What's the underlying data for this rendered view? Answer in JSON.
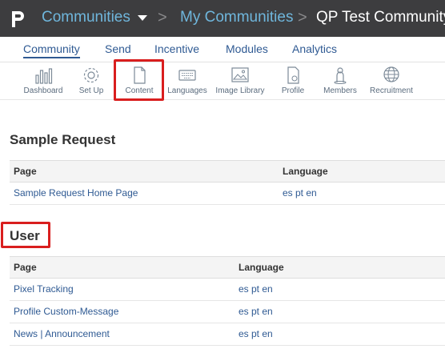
{
  "header": {
    "logo_icon": "p-logo-icon",
    "breadcrumb": [
      "Communities",
      "My Communities",
      "QP Test Community"
    ],
    "separator": ">"
  },
  "tabs": [
    {
      "label": "Community",
      "active": true
    },
    {
      "label": "Send"
    },
    {
      "label": "Incentive"
    },
    {
      "label": "Modules"
    },
    {
      "label": "Analytics"
    }
  ],
  "toolbar": [
    {
      "label": "Dashboard",
      "icon": "bar-chart-icon"
    },
    {
      "label": "Set Up",
      "icon": "gear-icon"
    },
    {
      "label": "Content",
      "icon": "document-icon",
      "highlighted": true
    },
    {
      "label": "Languages",
      "icon": "keyboard-icon"
    },
    {
      "label": "Image Library",
      "icon": "image-icon"
    },
    {
      "label": "Profile",
      "icon": "profile-doc-icon"
    },
    {
      "label": "Members",
      "icon": "person-icon"
    },
    {
      "label": "Recruitment",
      "icon": "globe-icon"
    }
  ],
  "sections": [
    {
      "title": "Sample Request",
      "columns": [
        "Page",
        "Language"
      ],
      "rows": [
        {
          "page": "Sample Request Home Page",
          "language": "es pt en"
        }
      ]
    },
    {
      "title": "User",
      "columns": [
        "Page",
        "Language"
      ],
      "rows": [
        {
          "page": "Pixel Tracking",
          "language": "es pt en"
        },
        {
          "page": "Profile Custom-Message",
          "language": "es pt en"
        },
        {
          "page": "News | Announcement",
          "language": "es pt en"
        }
      ]
    }
  ],
  "colors": {
    "topbar": "#3d3d3f",
    "link": "#2f5a93",
    "breadcrumb_link": "#6fb6dc",
    "highlight": "#d91e1e"
  }
}
